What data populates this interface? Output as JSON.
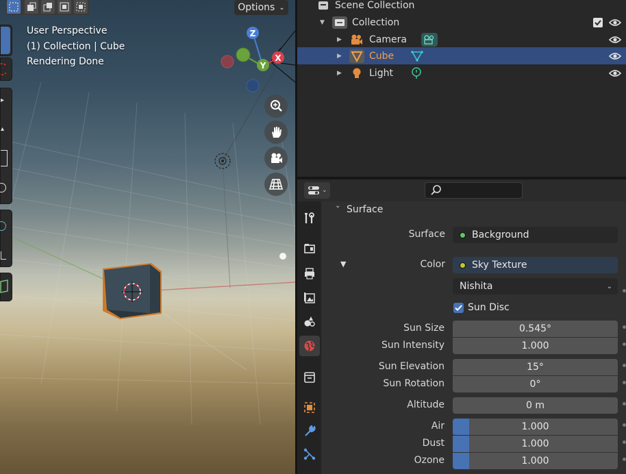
{
  "viewport": {
    "options_label": "Options",
    "overlay": {
      "line1": "User Perspective",
      "line2": "(1) Collection | Cube",
      "line3": "Rendering Done"
    },
    "gizmo": {
      "z": "Z",
      "x": "X",
      "y": "Y"
    }
  },
  "outliner": {
    "scene_collection": "Scene Collection",
    "collection": "Collection",
    "items": [
      {
        "label": "Camera",
        "icon": "camera-icon",
        "data_icon": "camera-data-icon",
        "selected": false
      },
      {
        "label": "Cube",
        "icon": "mesh-icon",
        "data_icon": "mesh-data-icon",
        "selected": true
      },
      {
        "label": "Light",
        "icon": "light-icon",
        "data_icon": "light-data-icon",
        "selected": false
      }
    ]
  },
  "properties": {
    "panel_title": "Surface",
    "surface": {
      "label": "Surface",
      "value": "Background",
      "socket_color": "#63c763"
    },
    "color": {
      "label": "Color",
      "value": "Sky Texture",
      "socket_color": "#c7c729"
    },
    "sky_type": "Nishita",
    "sun_disc": {
      "label": "Sun Disc",
      "checked": true
    },
    "sun_size": {
      "label": "Sun Size",
      "value": "0.545°"
    },
    "sun_intensity": {
      "label": "Sun Intensity",
      "value": "1.000"
    },
    "sun_elevation": {
      "label": "Sun Elevation",
      "value": "15°"
    },
    "sun_rotation": {
      "label": "Sun Rotation",
      "value": "0°"
    },
    "altitude": {
      "label": "Altitude",
      "value": "0 m"
    },
    "air": {
      "label": "Air",
      "value": "1.000",
      "fill": 0.1
    },
    "dust": {
      "label": "Dust",
      "value": "1.000",
      "fill": 0.1
    },
    "ozone": {
      "label": "Ozone",
      "value": "1.000",
      "fill": 0.1
    }
  },
  "colors": {
    "accent": "#4772b3",
    "selection": "#e8893a",
    "outliner_selected": "#334d80"
  }
}
